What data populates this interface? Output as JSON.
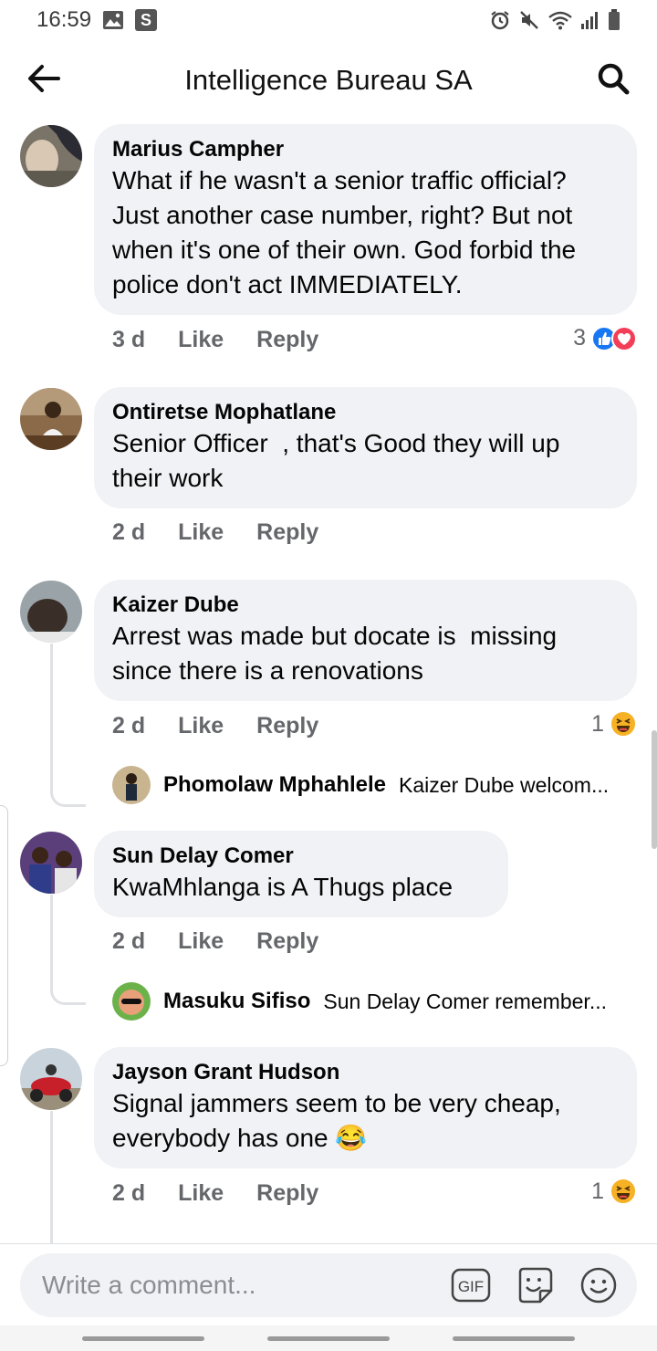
{
  "status_bar": {
    "time": "16:59",
    "icons": [
      "gallery-icon",
      "s-app-icon",
      "alarm-icon",
      "mute-icon",
      "wifi-icon",
      "signal-icon",
      "battery-icon"
    ],
    "s_label": "S"
  },
  "header": {
    "title": "Intelligence Bureau SA",
    "back_icon": "back-arrow-icon",
    "search_icon": "search-icon"
  },
  "comments": [
    {
      "author": "Marius Campher",
      "text": "What if he wasn't a senior traffic official?\nJust another case number, right? But not\nwhen it's one of their own. God forbid the\npolice don't act IMMEDIATELY.",
      "time": "3 d",
      "like_label": "Like",
      "reply_label": "Reply",
      "reaction_count": "3",
      "reactions": [
        "like",
        "love"
      ]
    },
    {
      "author": "Ontiretse Mophatlane",
      "text": "Senior Officer  , that's Good they will up\ntheir work",
      "time": "2 d",
      "like_label": "Like",
      "reply_label": "Reply"
    },
    {
      "author": "Kaizer Dube",
      "text": "Arrest was made but docate is  missing\nsince there is a renovations",
      "time": "2 d",
      "like_label": "Like",
      "reply_label": "Reply",
      "reaction_count": "1",
      "reactions": [
        "haha"
      ],
      "reply": {
        "author": "Phomolaw Mphahlele",
        "preview": "Kaizer Dube welcom..."
      }
    },
    {
      "author": "Sun Delay Comer",
      "text": "KwaMhlanga is A Thugs place",
      "time": "2 d",
      "like_label": "Like",
      "reply_label": "Reply",
      "reply": {
        "author": "Masuku Sifiso",
        "preview": "Sun Delay Comer remember..."
      }
    },
    {
      "author": "Jayson Grant Hudson",
      "text": "Signal jammers seem to be very cheap,\neverybody has one",
      "emoji": "😂",
      "time": "2 d",
      "like_label": "Like",
      "reply_label": "Reply",
      "reaction_count": "1",
      "reactions": [
        "haha"
      ]
    }
  ],
  "composer": {
    "placeholder": "Write a comment...",
    "gif_label": "GIF",
    "icons": [
      "gif-icon",
      "sticker-icon",
      "emoji-icon"
    ]
  },
  "colors": {
    "bubble": "#f0f2f5",
    "secondary_text": "#65676b",
    "like_blue": "#1877f2",
    "love_red": "#f33e58",
    "haha_yellow": "#f7b125"
  }
}
